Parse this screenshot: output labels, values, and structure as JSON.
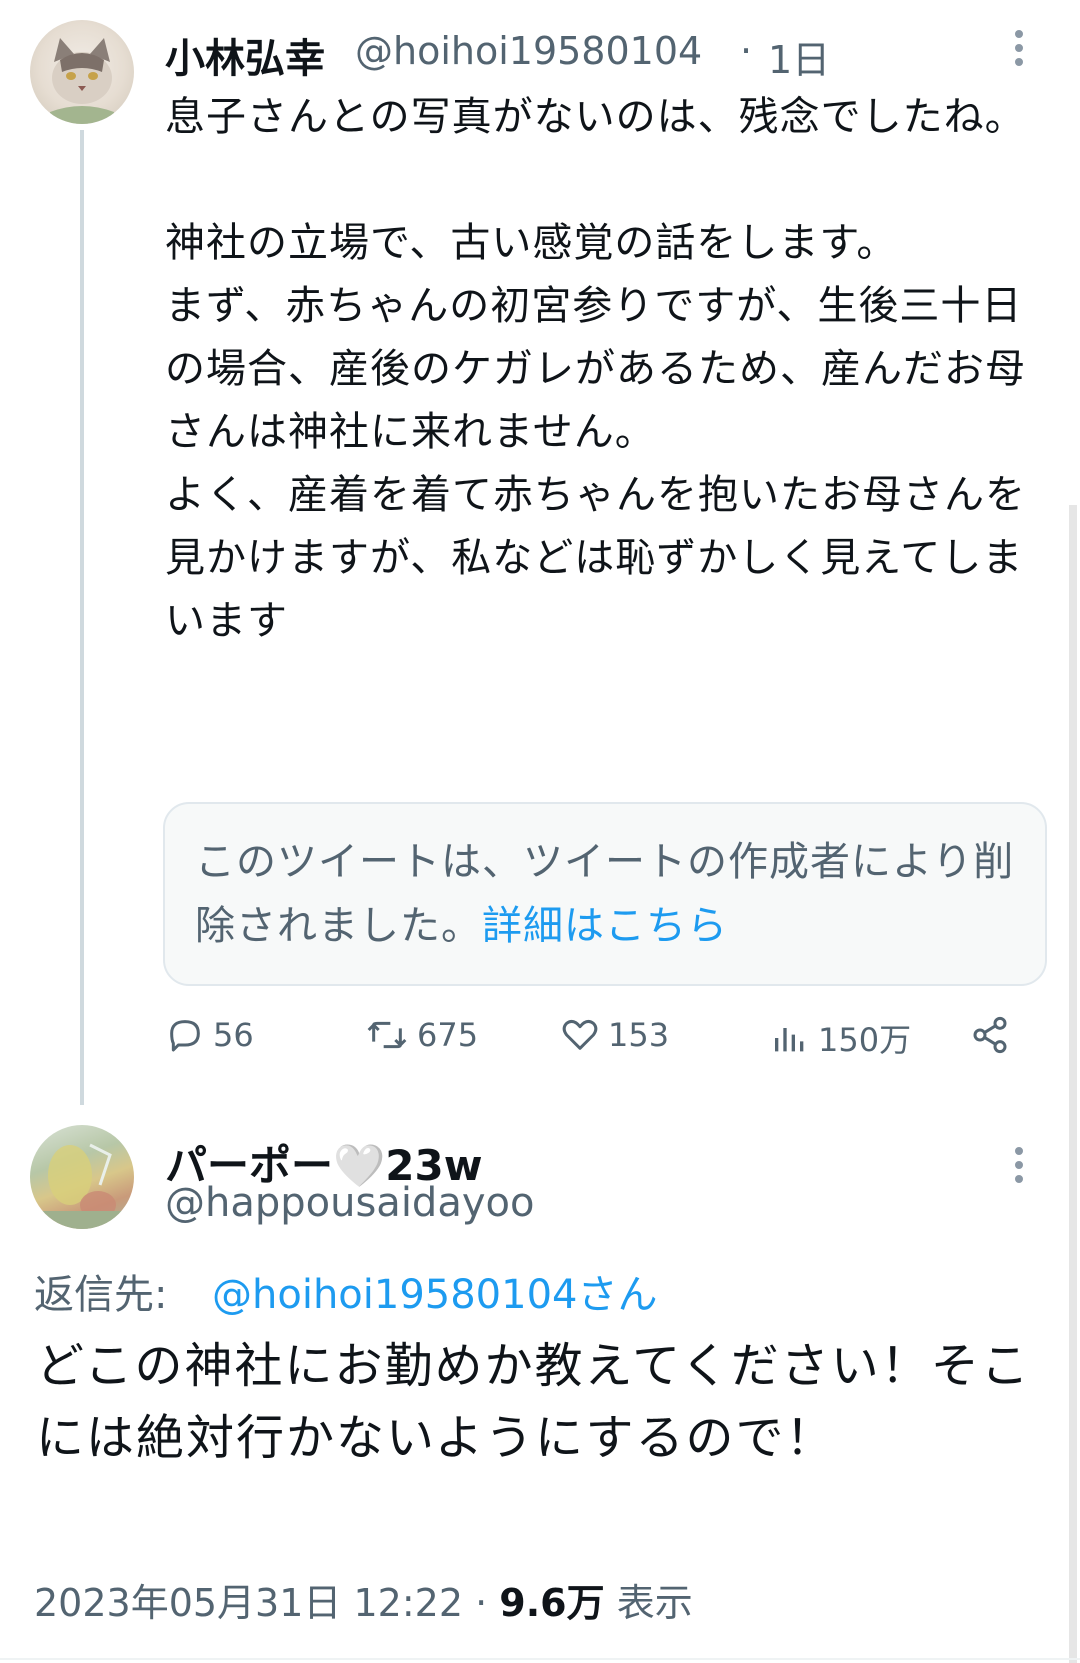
{
  "tweet": {
    "author_name": "小林弘幸",
    "author_handle": "@hoihoi19580104",
    "separator": "·",
    "time": "1日",
    "text": "息子さんとの写真がないのは、残念でしたね。\n\n神社の立場で、古い感覚の話をします。\nまず、赤ちゃんの初宮参りですが、生後三十日の場合、産後のケガレがあるため、産んだお母さんは神社に来れません。\nよく、産着を着て赤ちゃんを抱いたお母さんを見かけますが、私などは恥ずかしく見えてしまいます",
    "deleted_notice": "このツイートは、ツイートの作成者により削除されました。",
    "deleted_link": "詳細はこちら",
    "actions": {
      "replies": "56",
      "retweets": "675",
      "likes": "153",
      "views": "150万"
    }
  },
  "reply": {
    "author_name": "パーポー🤍23w",
    "author_handle": "@happousaidayoo",
    "reply_to_label": "返信先:",
    "reply_to_handle": "@hoihoi19580104さん",
    "text": "どこの神社にお勤めか教えてください！そこには絶対行かないようにするので！",
    "timestamp": "2023年05月31日 12:22",
    "separator": "·",
    "views_count": "9.6万",
    "views_label": "表示"
  },
  "icons": [
    "more-icon",
    "reply-icon",
    "retweet-icon",
    "like-icon",
    "views-icon",
    "share-icon"
  ],
  "colors": {
    "link": "#1d9bf0",
    "muted": "#536471",
    "text": "#0f1419",
    "border": "#e1e8ed"
  }
}
